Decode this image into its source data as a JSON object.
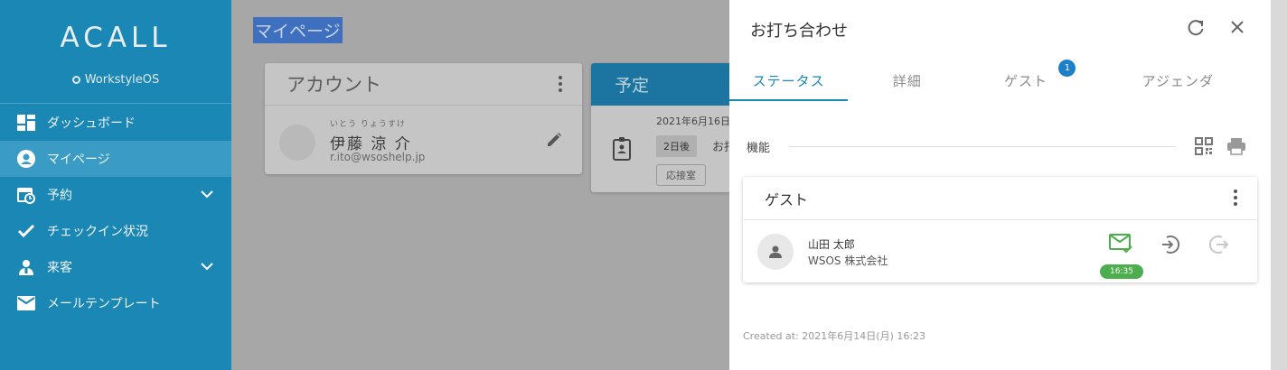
{
  "sidebar": {
    "logo": "ACALL",
    "logo_sub": "WorkstyleOS",
    "items": [
      {
        "label": "ダッシュボード",
        "icon": "dashboard-icon"
      },
      {
        "label": "マイページ",
        "icon": "account-circle-icon",
        "active": true
      },
      {
        "label": "予約",
        "icon": "calendar-clock-icon",
        "expandable": true
      },
      {
        "label": "チェックイン状況",
        "icon": "check-icon"
      },
      {
        "label": "来客",
        "icon": "visitor-icon",
        "expandable": true
      },
      {
        "label": "メールテンプレート",
        "icon": "mail-icon"
      }
    ]
  },
  "main": {
    "page_title": "マイページ",
    "account_card": {
      "title": "アカウント",
      "ruby": "いとう りょうすけ",
      "name": "伊藤 涼 介",
      "email": "r.ito@wsoshelp.jp"
    },
    "plan_card": {
      "title": "予定",
      "date": "2021年6月16日",
      "chip": "2日後",
      "text": "お打",
      "room": "応接室"
    }
  },
  "panel": {
    "title": "お打ち合わせ",
    "tabs": [
      {
        "label": "ステータス",
        "active": true
      },
      {
        "label": "詳細"
      },
      {
        "label": "ゲスト",
        "badge": "1"
      },
      {
        "label": "アジェンダ"
      }
    ],
    "section_label": "機能",
    "guest_card": {
      "title": "ゲスト",
      "guest_name": "山田 太郎",
      "guest_company": "WSOS 株式会社",
      "mail_time": "16:35"
    },
    "created_at": "Created at: 2021年6月14日(月) 16:23"
  },
  "colors": {
    "sidebar": "#1b87b4",
    "accent": "#1b87b4",
    "badge": "#1c7fc9",
    "mail_sent": "#4cae4c"
  }
}
